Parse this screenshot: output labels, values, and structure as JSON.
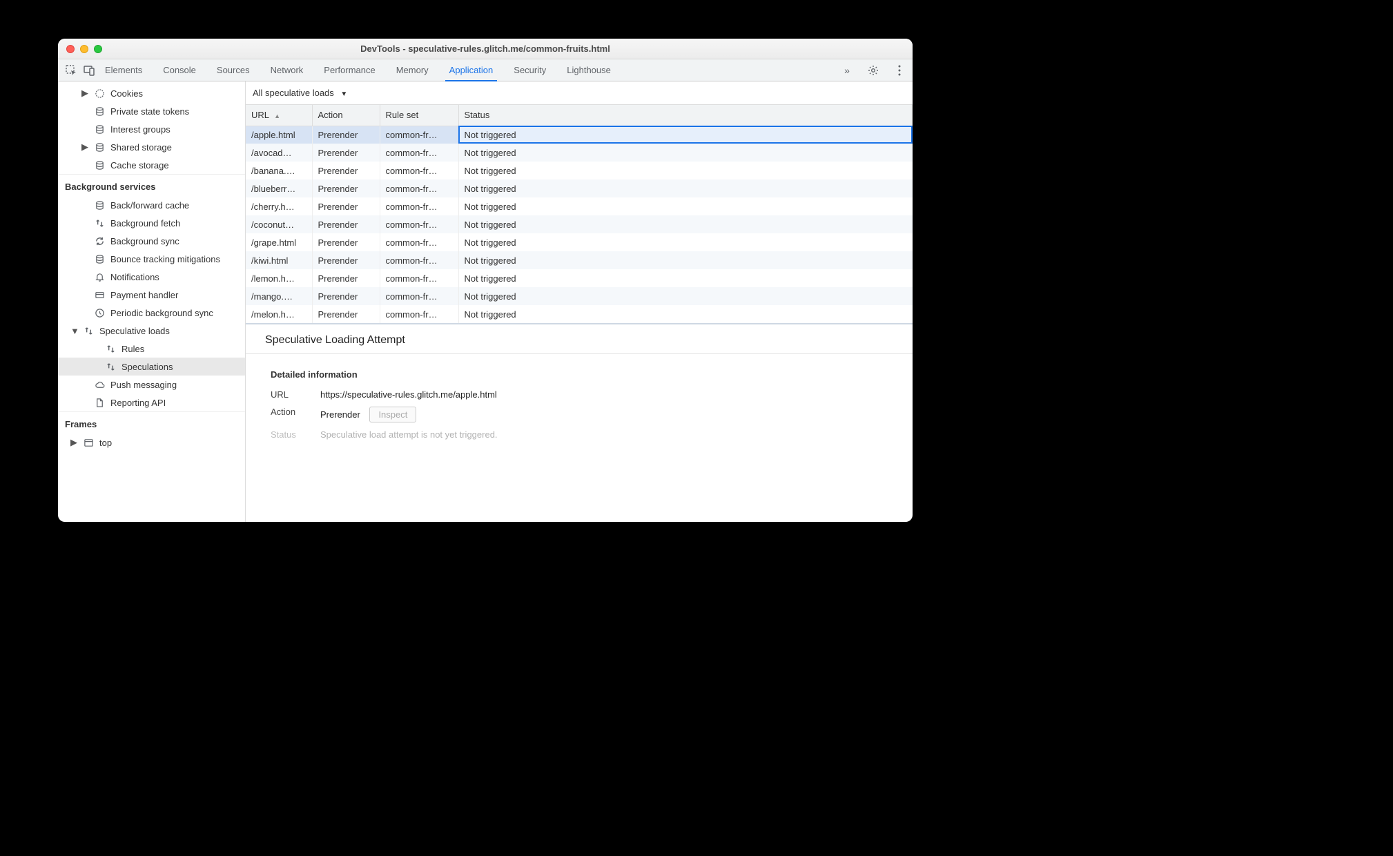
{
  "window": {
    "title": "DevTools - speculative-rules.glitch.me/common-fruits.html"
  },
  "tabs": {
    "items": [
      "Elements",
      "Console",
      "Sources",
      "Network",
      "Performance",
      "Memory",
      "Application",
      "Security",
      "Lighthouse"
    ],
    "active_index": 6,
    "overflow_glyph": "»"
  },
  "sidebar": {
    "storage_items": [
      {
        "label": "Cookies",
        "icon": "cookie",
        "arrow": "▶"
      },
      {
        "label": "Private state tokens",
        "icon": "db"
      },
      {
        "label": "Interest groups",
        "icon": "db"
      },
      {
        "label": "Shared storage",
        "icon": "db",
        "arrow": "▶"
      },
      {
        "label": "Cache storage",
        "icon": "db"
      }
    ],
    "bg_header": "Background services",
    "bg_items": [
      {
        "label": "Back/forward cache",
        "icon": "db"
      },
      {
        "label": "Background fetch",
        "icon": "updown"
      },
      {
        "label": "Background sync",
        "icon": "sync"
      },
      {
        "label": "Bounce tracking mitigations",
        "icon": "db"
      },
      {
        "label": "Notifications",
        "icon": "bell"
      },
      {
        "label": "Payment handler",
        "icon": "card"
      },
      {
        "label": "Periodic background sync",
        "icon": "clock"
      },
      {
        "label": "Speculative loads",
        "icon": "updown",
        "arrow": "▼",
        "children": [
          {
            "label": "Rules",
            "icon": "updown"
          },
          {
            "label": "Speculations",
            "icon": "updown",
            "selected": true
          }
        ]
      },
      {
        "label": "Push messaging",
        "icon": "cloud"
      },
      {
        "label": "Reporting API",
        "icon": "file"
      }
    ],
    "frames_header": "Frames",
    "frames_items": [
      {
        "label": "top",
        "icon": "frame",
        "arrow": "▶"
      }
    ]
  },
  "filter": {
    "label": "All speculative loads",
    "caret": "▼"
  },
  "columns": {
    "url": "URL",
    "action": "Action",
    "ruleset": "Rule set",
    "status": "Status",
    "sort_glyph": "▲"
  },
  "rows": [
    {
      "url": "/apple.html",
      "action": "Prerender",
      "ruleset": "common-fr…",
      "status": "Not triggered",
      "selected": true
    },
    {
      "url": "/avocad…",
      "action": "Prerender",
      "ruleset": "common-fr…",
      "status": "Not triggered"
    },
    {
      "url": "/banana.…",
      "action": "Prerender",
      "ruleset": "common-fr…",
      "status": "Not triggered"
    },
    {
      "url": "/blueberr…",
      "action": "Prerender",
      "ruleset": "common-fr…",
      "status": "Not triggered"
    },
    {
      "url": "/cherry.h…",
      "action": "Prerender",
      "ruleset": "common-fr…",
      "status": "Not triggered"
    },
    {
      "url": "/coconut…",
      "action": "Prerender",
      "ruleset": "common-fr…",
      "status": "Not triggered"
    },
    {
      "url": "/grape.html",
      "action": "Prerender",
      "ruleset": "common-fr…",
      "status": "Not triggered"
    },
    {
      "url": "/kiwi.html",
      "action": "Prerender",
      "ruleset": "common-fr…",
      "status": "Not triggered"
    },
    {
      "url": "/lemon.h…",
      "action": "Prerender",
      "ruleset": "common-fr…",
      "status": "Not triggered"
    },
    {
      "url": "/mango.…",
      "action": "Prerender",
      "ruleset": "common-fr…",
      "status": "Not triggered"
    },
    {
      "url": "/melon.h…",
      "action": "Prerender",
      "ruleset": "common-fr…",
      "status": "Not triggered"
    }
  ],
  "detail": {
    "title": "Speculative Loading Attempt",
    "section": "Detailed information",
    "url_label": "URL",
    "url_value": "https://speculative-rules.glitch.me/apple.html",
    "action_label": "Action",
    "action_value": "Prerender",
    "inspect_label": "Inspect",
    "status_label": "Status",
    "status_value": "Speculative load attempt is not yet triggered."
  }
}
